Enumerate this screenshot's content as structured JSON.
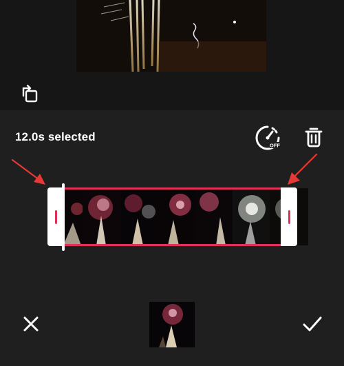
{
  "header": {
    "selected_label": "12.0s selected"
  },
  "speed_badge": "OFF",
  "icons": {
    "rotate": "rotate-icon",
    "speed": "speed-off-icon",
    "delete": "trash-icon",
    "cancel": "close-icon",
    "confirm": "checkmark-icon"
  },
  "colors": {
    "accent": "#e0305a",
    "arrow": "#e53935",
    "panel_bg": "#1f1f1f",
    "page_bg": "#121212"
  }
}
